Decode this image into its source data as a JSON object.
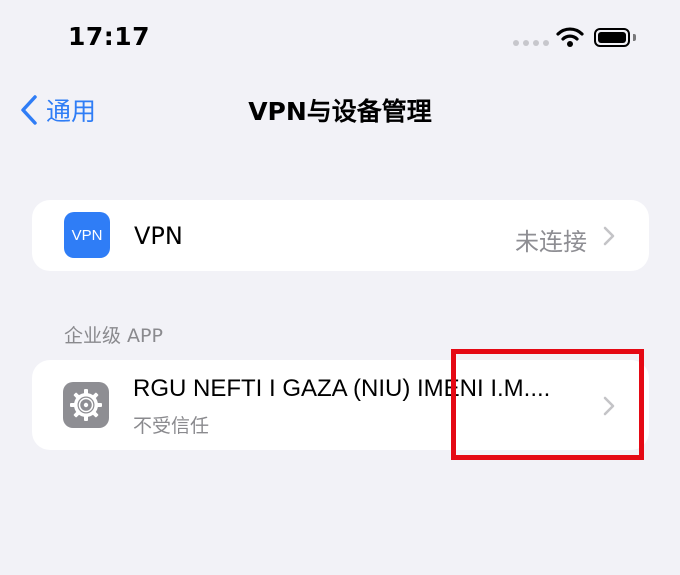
{
  "status_bar": {
    "time": "17:17"
  },
  "nav": {
    "back_label": "通用",
    "title": "VPN与设备管理"
  },
  "vpn_row": {
    "icon_text": "VPN",
    "label": "VPN",
    "status": "未连接"
  },
  "section": {
    "header": "企业级 APP"
  },
  "app_row": {
    "name": "RGU NEFTI I GAZA (NIU) IMENI I.M....",
    "subtitle": "不受信任"
  },
  "colors": {
    "accent": "#2f7df6",
    "highlight": "#e50914",
    "background": "#f2f2f7"
  },
  "icons": [
    "wifi-icon",
    "battery-icon",
    "back-chevron-icon",
    "chevron-right-icon",
    "gear-icon"
  ]
}
